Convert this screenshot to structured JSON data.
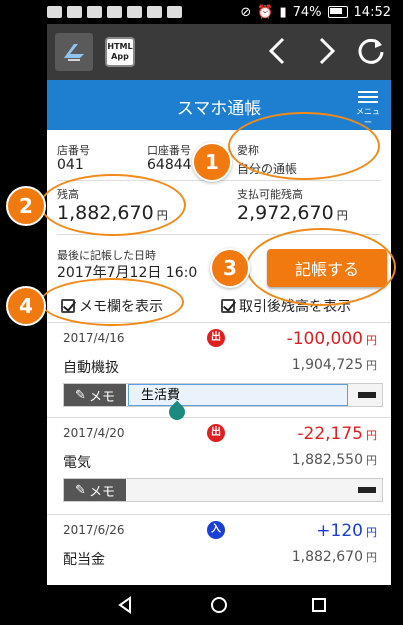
{
  "status": {
    "battery": "74%",
    "time": "14:52"
  },
  "toolbar": {
    "html_app": "HTML App"
  },
  "header": {
    "title": "スマホ通帳",
    "menu_label": "メニュー"
  },
  "account": {
    "branch_label": "店番号",
    "branch_value": "041",
    "number_label": "口座番号",
    "number_value": "64844",
    "nickname_label": "愛称",
    "nickname_value": "自分の通帳",
    "balance_label": "残高",
    "balance_value": "1,882,670",
    "available_label": "支払可能残高",
    "available_value": "2,972,670",
    "last_date_label": "最後に記帳した日時",
    "last_date_value": "2017年7月12日 16:0",
    "yen": "円"
  },
  "buttons": {
    "ledger": "記帳する"
  },
  "options": {
    "show_memo": "メモ欄を表示",
    "show_balance": "取引後残高を表示"
  },
  "transactions": [
    {
      "date": "2017/4/16",
      "badge": "出",
      "badge_color": "#e02020",
      "name": "自動機扱",
      "amount": "-100,000",
      "amount_color": "#e02020",
      "balance": "1,904,725",
      "memo": "生活費"
    },
    {
      "date": "2017/4/20",
      "badge": "出",
      "badge_color": "#e02020",
      "name": "電気",
      "amount": "-22,175",
      "amount_color": "#e02020",
      "balance": "1,882,550",
      "memo": ""
    },
    {
      "date": "2017/6/26",
      "badge": "入",
      "badge_color": "#1a3fd6",
      "name": "配当金",
      "amount": "+120",
      "amount_color": "#1a3fd6",
      "balance": "1,882,670"
    }
  ],
  "memo_label": "メモ",
  "callouts": [
    "1",
    "2",
    "3",
    "4"
  ],
  "colors": {
    "header": "#1e7fd1",
    "accent": "#f07a10"
  }
}
